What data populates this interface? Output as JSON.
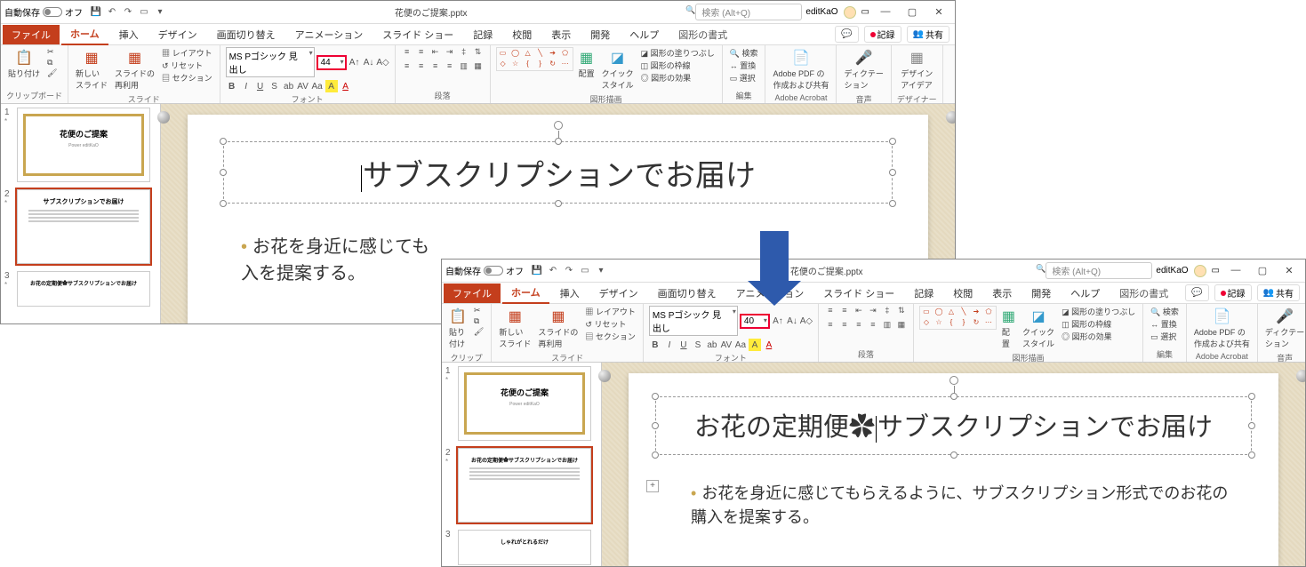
{
  "autosave_label": "自動保存",
  "autosave_state": "オフ",
  "doc_title": "花便のご提案.pptx",
  "search_placeholder": "検索 (Alt+Q)",
  "user": "editKaO",
  "tabs": {
    "file": "ファイル",
    "home": "ホーム",
    "insert": "挿入",
    "design": "デザイン",
    "transitions": "画面切り替え",
    "animations": "アニメーション",
    "slideshow": "スライド ショー",
    "record": "記録",
    "review": "校閲",
    "view": "表示",
    "developer": "開発",
    "help": "ヘルプ",
    "shape_format": "図形の書式"
  },
  "rbtns": {
    "comments": "",
    "record": "記録",
    "share": "共有"
  },
  "ribbon": {
    "clipboard": {
      "paste": "貼り付け",
      "label": "クリップボード"
    },
    "slides": {
      "new": "新しい\nスライド",
      "reuse": "スライドの\n再利用",
      "layout": "レイアウト",
      "reset": "リセット",
      "section": "セクション",
      "label": "スライド"
    },
    "font": {
      "name": "MS Pゴシック 見出し",
      "size1": "44",
      "size2": "40",
      "label": "フォント"
    },
    "para": {
      "label": "段落"
    },
    "drawing": {
      "arrange": "配置",
      "quick": "クイック\nスタイル",
      "fill": "図形の塗りつぶし",
      "outline": "図形の枠線",
      "effects": "図形の効果",
      "label": "図形描画"
    },
    "editing": {
      "find": "検索",
      "replace": "置換",
      "select": "選択",
      "label": "編集"
    },
    "acrobat": {
      "btn": "Adobe PDF の\n作成および共有",
      "label": "Adobe Acrobat"
    },
    "voice": {
      "btn": "ディクテー\nション",
      "label": "音声"
    },
    "designer": {
      "btn": "デザイン\nアイデア",
      "label": "デザイナー"
    }
  },
  "thumbs": {
    "s1_title": "花便のご提案",
    "s2_title_a": "サブスクリプションでお届け",
    "s2_title_b": "お花の定期便✿サブスクリプションでお届け",
    "s3_title": "お花の定期便✿サブスクリプションでお届け",
    "s3_alt": "しゃれがとれるだけ"
  },
  "slide1": {
    "title": "サブスクリプションでお届け",
    "body": "お花を身近に感じてもらえるように、サブスクリプション形式でのお花の購入を提案する。",
    "body_partial": "お花を身近に感じても\n入を提案する。"
  },
  "slide2": {
    "title_a": "お花の定期便✿",
    "title_b": "サブスクリプションでお届け",
    "body": "お花を身近に感じてもらえるように、サブスクリプション形式でのお花の購入を提案する。"
  }
}
